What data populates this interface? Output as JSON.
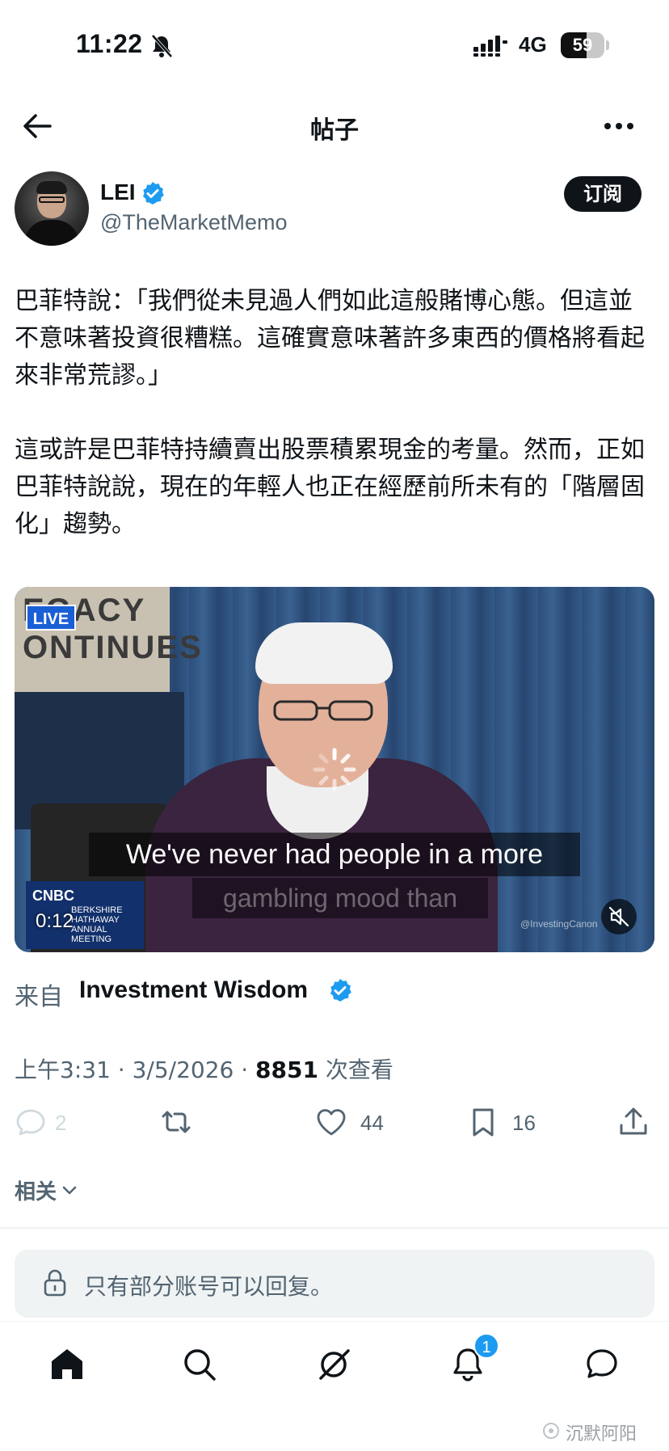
{
  "status_bar": {
    "time": "11:22",
    "network": "4G",
    "battery_level": 59,
    "battery_text": "59",
    "icons": [
      "bell-off-icon",
      "signal-icon",
      "battery-icon"
    ]
  },
  "header": {
    "title": "帖子",
    "icons": [
      "back-arrow-icon",
      "more-dots-icon"
    ]
  },
  "author": {
    "name": "LEI",
    "handle": "@TheMarketMemo",
    "verified": true,
    "subscribe_label": "订阅"
  },
  "post": {
    "paragraphs": [
      "巴菲特說：「我們從未見過人們如此這般賭博心態。但這並不意味著投資很糟糕。這確實意味著許多東西的價格將看起來非常荒謬。」",
      "這或許是巴菲特持續賣出股票積累現金的考量。然而，正如巴菲特說說，現在的年輕人也正在經歷前所未有的「階層固化」趨勢。"
    ]
  },
  "media": {
    "live_label": "LIVE",
    "banner_text_line1": "EGACY",
    "banner_text_line2": "ONTINUES",
    "caption_line1": "We've never had people in a more",
    "caption_line2": "gambling mood than",
    "network_logo": "CNBC",
    "network_sub": "BERKSHIRE\nHATHAWAY\nANNUAL MEETING",
    "duration": "0:12",
    "watermark": "@InvestingCanon"
  },
  "source": {
    "label": "来自",
    "name": "Investment Wisdom",
    "verified": true
  },
  "meta": {
    "time": "上午3:31 · 3/5/2026 · ",
    "views": "8851",
    "views_suffix": " 次查看"
  },
  "actions": {
    "reply_count": "2",
    "like_count": "44",
    "bookmark_count": "16",
    "icons": [
      "reply-icon",
      "retweet-icon",
      "like-icon",
      "bookmark-icon",
      "share-icon"
    ]
  },
  "related_label": "相关",
  "reply_box": {
    "text": "只有部分账号可以回复。"
  },
  "tabbar": {
    "notification_badge": "1",
    "icons": [
      "home-icon",
      "search-icon",
      "grok-icon",
      "notifications-icon",
      "messages-icon"
    ]
  },
  "watermark_text": "沉默阿阳",
  "colors": {
    "accent": "#1d9bf0",
    "text": "#0f1419",
    "secondary_text": "#536471"
  }
}
